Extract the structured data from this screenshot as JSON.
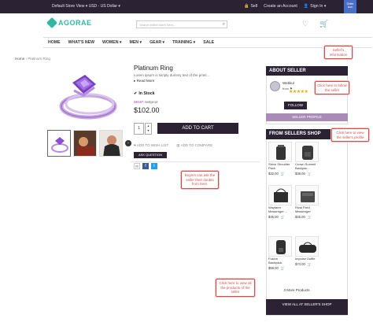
{
  "topbar": {
    "store_view": "Default Store View ▾ USD - US Dollar ▾",
    "sell": "Sell",
    "create_account": "Create an Account",
    "sign_in": "Sign In ▾",
    "badge": "Seller Icon"
  },
  "header": {
    "logo": "AGORAE",
    "search_placeholder": "Search entire store here..."
  },
  "nav": [
    "HOME",
    "WHAT'S NEW",
    "WOMEN ▾",
    "MEN ▾",
    "GEAR ▾",
    "TRAINING ▾",
    "SALE"
  ],
  "breadcrumb": {
    "home": "Home",
    "current": "Platinum Ring"
  },
  "product": {
    "title": "Platinum Ring",
    "desc": "Lorem ipsum is simply dummy text of the printi...",
    "read_more": "▸ Read More",
    "stock": "In Stock",
    "sku_label": "SKU#:",
    "sku_value": "testpro2",
    "price": "$102.00",
    "qty": "1",
    "add_to_cart": "ADD TO CART",
    "wish": "ADD TO WISH LIST",
    "compare": "ADD TO COMPARE",
    "ask": "ASK QUESTION"
  },
  "seller": {
    "header": "ABOUT SELLER",
    "name": "Webkul",
    "from": "from ⚑",
    "stars": "★★★★★",
    "follow": "FOLLOW",
    "profile": "SELLER PROFILE"
  },
  "shop": {
    "header": "FROM SELLERS SHOP",
    "products": [
      {
        "name": "Strive Shoulder Pack",
        "price": "$32.00"
      },
      {
        "name": "Crown Summit Backpac...",
        "price": "$38.00"
      },
      {
        "name": "Wayfarer Messenger ...",
        "price": "$45.00"
      },
      {
        "name": "Rival Field Messenger",
        "price": "$45.00"
      },
      {
        "name": "Fusion Backpack",
        "price": "$59.00"
      },
      {
        "name": "Impulse Duffle",
        "price": "$74.00"
      }
    ],
    "more": "3 More Products",
    "view_all": "VIEW ALL AT SELLER'S SHOP"
  },
  "callouts": {
    "seller_info": "Seller's information",
    "follow": "Click here to follow the seller",
    "profile": "Click here to view the seller's profile",
    "ask": "Buyers can ask the seller their doubts from here.",
    "view_all": "Click here to view all the products of the seller"
  }
}
